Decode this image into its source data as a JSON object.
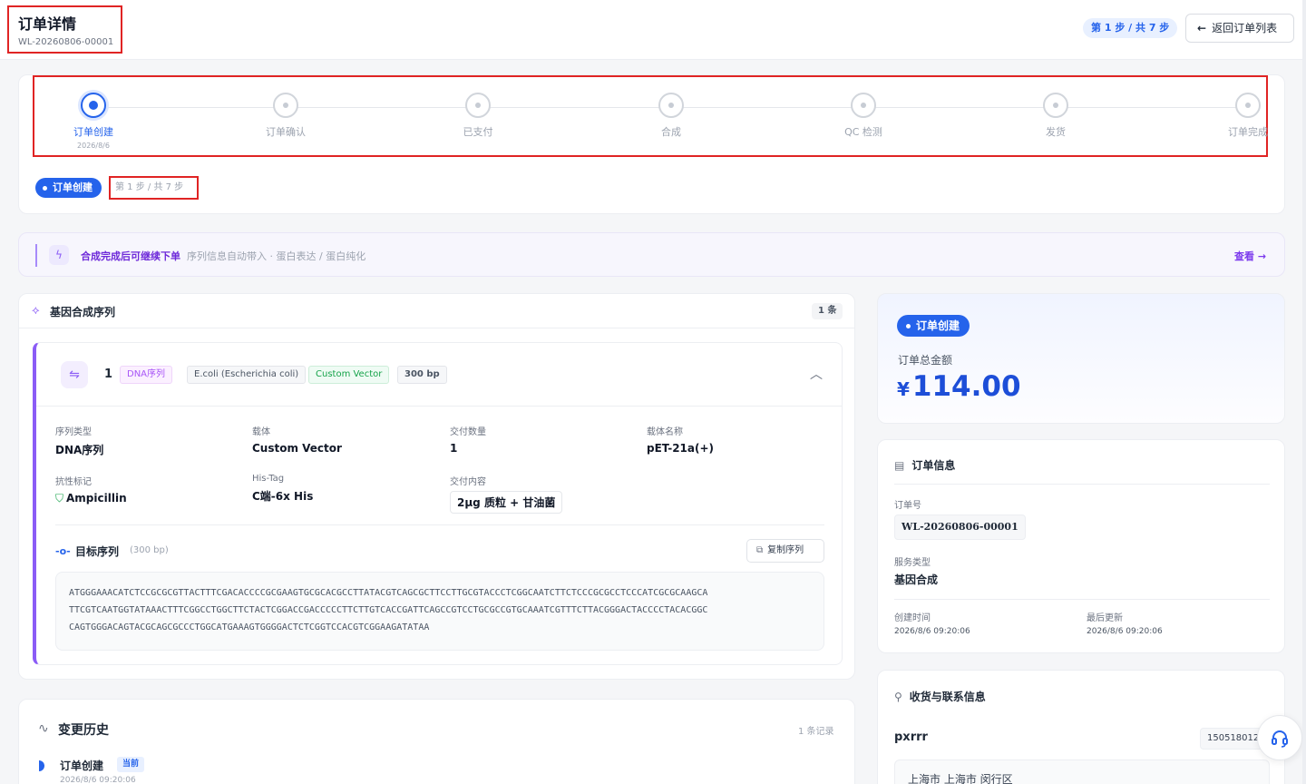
{
  "header": {
    "title": "订单详情",
    "order_no": "WL-20260806-00001",
    "step_indicator": "第 1 步 / 共 7 步",
    "back_label": "返回订单列表"
  },
  "stepper": {
    "steps": [
      {
        "label": "订单创建",
        "date": "2026/8/6",
        "active": true
      },
      {
        "label": "订单确认",
        "date": ""
      },
      {
        "label": "已支付",
        "date": ""
      },
      {
        "label": "合成",
        "date": ""
      },
      {
        "label": "QC 检测",
        "date": ""
      },
      {
        "label": "发货",
        "date": ""
      },
      {
        "label": "订单完成",
        "date": ""
      }
    ],
    "current_status": "订单创建",
    "step_count": "第 1 步 / 共 7 步"
  },
  "hint": {
    "title": "合成完成后可继续下单",
    "desc": "序列信息自动带入 · 蛋白表达 / 蛋白纯化",
    "link": "查看"
  },
  "sequence_section": {
    "title": "基因合成序列",
    "count": "1 条",
    "item": {
      "index": "1",
      "tags": {
        "type": "DNA序列",
        "host": "E.coli (Escherichia coli)",
        "vector": "Custom Vector",
        "length": "300 bp"
      },
      "fields": {
        "seq_type_label": "序列类型",
        "seq_type": "DNA序列",
        "vector_label": "载体",
        "vector": "Custom Vector",
        "qty_label": "交付数量",
        "qty": "1",
        "vector_name_label": "载体名称",
        "vector_name": "pET-21a(+)",
        "resistance_label": "抗性标记",
        "resistance": "Ampicillin",
        "tag_label": "His-Tag",
        "tag": "C端-6x His",
        "delivery_label": "交付内容",
        "delivery": "2μg 质粒 + 甘油菌"
      },
      "target_label": "目标序列",
      "target_length": "(300 bp)",
      "copy_label": "复制序列",
      "sequence_lines": [
        "ATGGGAAACATCTCCGCGCGTTACTTTCGACACCCCGCGAAGTGCGCACGCCTTATACGTCAGCGCTTCCTTGCGTACCCTCGGCAATCTTCTCCCGCGCCTCCCATCGCGCAAGCA",
        "TTCGTCAATGGTATAAACTTTCGGCCTGGCTTCTACTCGGACCGACCCCCTTCTTGTCACCGATTCAGCCGTCCTGCGCCGTGCAAATCGTTTCTTACGGGACTACCCCTACACGGC",
        "CAGTGGGACAGTACGCAGCGCCCTGGCATGAAAGTGGGGACTCTCGGTCCACGTCGGAAGATATAA"
      ]
    }
  },
  "history": {
    "title": "变更历史",
    "count": "1 条记录",
    "entry": {
      "label": "订单创建",
      "badge": "当前",
      "time": "2026/8/6 09:20:06"
    }
  },
  "amount": {
    "status": "订单创建",
    "label": "订单总金额",
    "currency": "¥",
    "value": "114.00"
  },
  "order_info": {
    "title": "订单信息",
    "order_no_label": "订单号",
    "order_no": "WL-20260806-00001",
    "service_label": "服务类型",
    "service": "基因合成",
    "created_label": "创建时间",
    "created": "2026/8/6 09:20:06",
    "updated_label": "最后更新",
    "updated": "2026/8/6 09:20:06"
  },
  "shipping": {
    "title": "收货与联系信息",
    "name": "pxrrr",
    "phone": "1505180125",
    "address": "上海市 上海市 闵行区"
  },
  "colors": {
    "primary": "#2563eb",
    "purple": "#8b5cf6",
    "highlight_border": "#e02424",
    "green": "#16a34a"
  }
}
